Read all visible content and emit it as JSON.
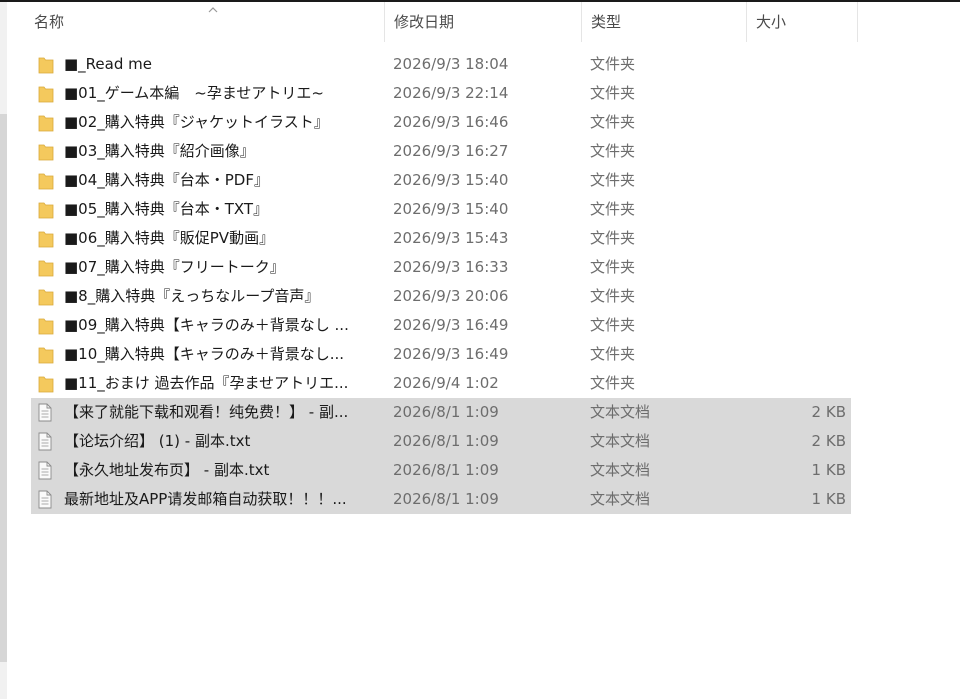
{
  "columns": {
    "name": "名称",
    "date": "修改日期",
    "type": "类型",
    "size": "大小"
  },
  "files": [
    {
      "kind": "folder",
      "name": "■_Read me",
      "date": "2026/9/3 18:04",
      "type": "文件夹",
      "size": ""
    },
    {
      "kind": "folder",
      "name": "■01_ゲーム本編　~孕ませアトリエ~",
      "date": "2026/9/3 22:14",
      "type": "文件夹",
      "size": ""
    },
    {
      "kind": "folder",
      "name": "■02_購入特典『ジャケットイラスト』",
      "date": "2026/9/3 16:46",
      "type": "文件夹",
      "size": ""
    },
    {
      "kind": "folder",
      "name": "■03_購入特典『紹介画像』",
      "date": "2026/9/3 16:27",
      "type": "文件夹",
      "size": ""
    },
    {
      "kind": "folder",
      "name": "■04_購入特典『台本・PDF』",
      "date": "2026/9/3 15:40",
      "type": "文件夹",
      "size": ""
    },
    {
      "kind": "folder",
      "name": "■05_購入特典『台本・TXT』",
      "date": "2026/9/3 15:40",
      "type": "文件夹",
      "size": ""
    },
    {
      "kind": "folder",
      "name": "■06_購入特典『販促PV動画』",
      "date": "2026/9/3 15:43",
      "type": "文件夹",
      "size": ""
    },
    {
      "kind": "folder",
      "name": "■07_購入特典『フリートーク』",
      "date": "2026/9/3 16:33",
      "type": "文件夹",
      "size": ""
    },
    {
      "kind": "folder",
      "name": "■8_購入特典『えっちなループ音声』",
      "date": "2026/9/3 20:06",
      "type": "文件夹",
      "size": ""
    },
    {
      "kind": "folder",
      "name": "■09_購入特典【キャラのみ＋背景なし ...",
      "date": "2026/9/3 16:49",
      "type": "文件夹",
      "size": ""
    },
    {
      "kind": "folder",
      "name": "■10_購入特典【キャラのみ＋背景なし...",
      "date": "2026/9/3 16:49",
      "type": "文件夹",
      "size": ""
    },
    {
      "kind": "folder",
      "name": "■11_おまけ 過去作品『孕ませアトリエ...",
      "date": "2026/9/4 1:02",
      "type": "文件夹",
      "size": ""
    },
    {
      "kind": "text",
      "name": "【来了就能下载和观看！纯免费！】 - 副...",
      "date": "2026/8/1 1:09",
      "type": "文本文档",
      "size": "2 KB",
      "selected": true
    },
    {
      "kind": "text",
      "name": "【论坛介绍】 (1) - 副本.txt",
      "date": "2026/8/1 1:09",
      "type": "文本文档",
      "size": "2 KB",
      "selected": true
    },
    {
      "kind": "text",
      "name": "【永久地址发布页】 - 副本.txt",
      "date": "2026/8/1 1:09",
      "type": "文本文档",
      "size": "1 KB",
      "selected": true
    },
    {
      "kind": "text",
      "name": "最新地址及APP请发邮箱自动获取！！！...",
      "date": "2026/8/1 1:09",
      "type": "文本文档",
      "size": "1 KB",
      "selected": true
    }
  ],
  "colors": {
    "selection": "#d9d9d9",
    "folder": "#f4c95d",
    "secondary_text": "#6d6d6d"
  },
  "icons": {
    "folder": "folder-icon",
    "text": "text-document-icon",
    "sort": "sort-ascending-icon"
  }
}
